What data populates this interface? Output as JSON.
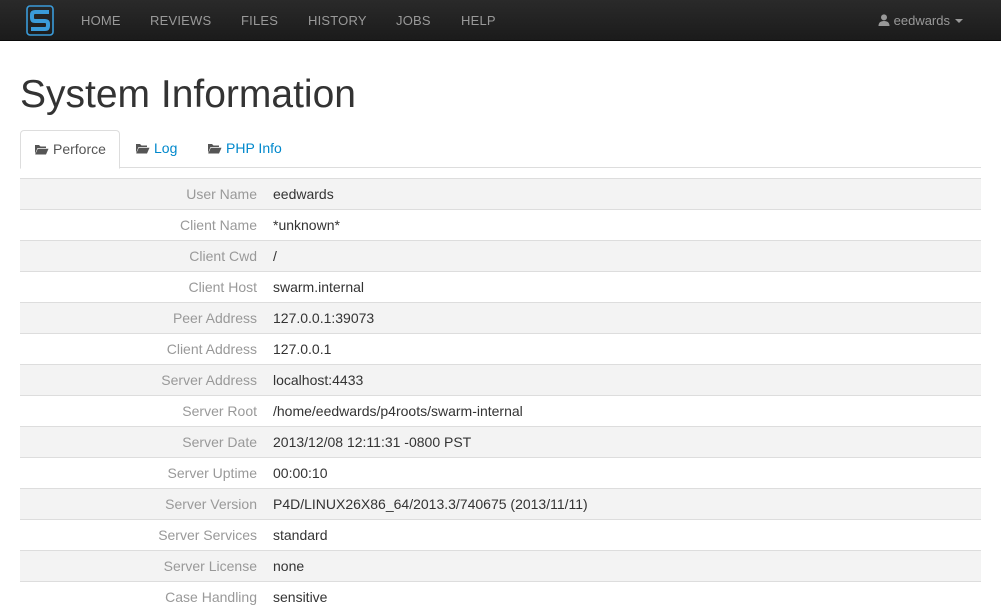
{
  "navbar": {
    "logo": "swarm-logo",
    "items": [
      {
        "label": "HOME"
      },
      {
        "label": "REVIEWS"
      },
      {
        "label": "FILES"
      },
      {
        "label": "HISTORY"
      },
      {
        "label": "JOBS"
      },
      {
        "label": "HELP"
      }
    ],
    "user": {
      "name": "eedwards",
      "icon": "user-icon"
    }
  },
  "page": {
    "title": "System Information"
  },
  "tabs": [
    {
      "label": "Perforce",
      "icon": "folder-open-icon",
      "active": true
    },
    {
      "label": "Log",
      "icon": "folder-open-icon",
      "active": false
    },
    {
      "label": "PHP Info",
      "icon": "folder-open-icon",
      "active": false
    }
  ],
  "info": [
    {
      "label": "User Name",
      "value": "eedwards"
    },
    {
      "label": "Client Name",
      "value": "*unknown*"
    },
    {
      "label": "Client Cwd",
      "value": "/"
    },
    {
      "label": "Client Host",
      "value": "swarm.internal"
    },
    {
      "label": "Peer Address",
      "value": "127.0.0.1:39073"
    },
    {
      "label": "Client Address",
      "value": "127.0.0.1"
    },
    {
      "label": "Server Address",
      "value": "localhost:4433"
    },
    {
      "label": "Server Root",
      "value": "/home/eedwards/p4roots/swarm-internal"
    },
    {
      "label": "Server Date",
      "value": "2013/12/08 12:11:31 -0800 PST"
    },
    {
      "label": "Server Uptime",
      "value": "00:00:10"
    },
    {
      "label": "Server Version",
      "value": "P4D/LINUX26X86_64/2013.3/740675 (2013/11/11)"
    },
    {
      "label": "Server Services",
      "value": "standard"
    },
    {
      "label": "Server License",
      "value": "none"
    },
    {
      "label": "Case Handling",
      "value": "sensitive"
    }
  ],
  "colors": {
    "navbar_bg": "#1b1b1b",
    "nav_text": "#999999",
    "link": "#0088cc",
    "logo_blue": "#3a9bd9",
    "row_stripe": "#f3f3f3",
    "label_text": "#999999"
  }
}
